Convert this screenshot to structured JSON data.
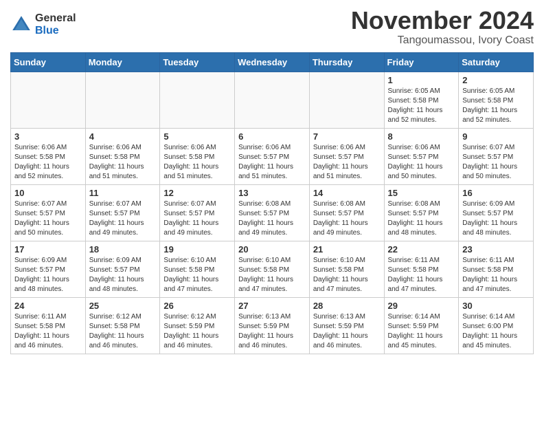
{
  "header": {
    "logo_general": "General",
    "logo_blue": "Blue",
    "month_title": "November 2024",
    "location": "Tangoumassou, Ivory Coast"
  },
  "weekdays": [
    "Sunday",
    "Monday",
    "Tuesday",
    "Wednesday",
    "Thursday",
    "Friday",
    "Saturday"
  ],
  "weeks": [
    [
      {
        "day": "",
        "info": ""
      },
      {
        "day": "",
        "info": ""
      },
      {
        "day": "",
        "info": ""
      },
      {
        "day": "",
        "info": ""
      },
      {
        "day": "",
        "info": ""
      },
      {
        "day": "1",
        "info": "Sunrise: 6:05 AM\nSunset: 5:58 PM\nDaylight: 11 hours\nand 52 minutes."
      },
      {
        "day": "2",
        "info": "Sunrise: 6:05 AM\nSunset: 5:58 PM\nDaylight: 11 hours\nand 52 minutes."
      }
    ],
    [
      {
        "day": "3",
        "info": "Sunrise: 6:06 AM\nSunset: 5:58 PM\nDaylight: 11 hours\nand 52 minutes."
      },
      {
        "day": "4",
        "info": "Sunrise: 6:06 AM\nSunset: 5:58 PM\nDaylight: 11 hours\nand 51 minutes."
      },
      {
        "day": "5",
        "info": "Sunrise: 6:06 AM\nSunset: 5:58 PM\nDaylight: 11 hours\nand 51 minutes."
      },
      {
        "day": "6",
        "info": "Sunrise: 6:06 AM\nSunset: 5:57 PM\nDaylight: 11 hours\nand 51 minutes."
      },
      {
        "day": "7",
        "info": "Sunrise: 6:06 AM\nSunset: 5:57 PM\nDaylight: 11 hours\nand 51 minutes."
      },
      {
        "day": "8",
        "info": "Sunrise: 6:06 AM\nSunset: 5:57 PM\nDaylight: 11 hours\nand 50 minutes."
      },
      {
        "day": "9",
        "info": "Sunrise: 6:07 AM\nSunset: 5:57 PM\nDaylight: 11 hours\nand 50 minutes."
      }
    ],
    [
      {
        "day": "10",
        "info": "Sunrise: 6:07 AM\nSunset: 5:57 PM\nDaylight: 11 hours\nand 50 minutes."
      },
      {
        "day": "11",
        "info": "Sunrise: 6:07 AM\nSunset: 5:57 PM\nDaylight: 11 hours\nand 49 minutes."
      },
      {
        "day": "12",
        "info": "Sunrise: 6:07 AM\nSunset: 5:57 PM\nDaylight: 11 hours\nand 49 minutes."
      },
      {
        "day": "13",
        "info": "Sunrise: 6:08 AM\nSunset: 5:57 PM\nDaylight: 11 hours\nand 49 minutes."
      },
      {
        "day": "14",
        "info": "Sunrise: 6:08 AM\nSunset: 5:57 PM\nDaylight: 11 hours\nand 49 minutes."
      },
      {
        "day": "15",
        "info": "Sunrise: 6:08 AM\nSunset: 5:57 PM\nDaylight: 11 hours\nand 48 minutes."
      },
      {
        "day": "16",
        "info": "Sunrise: 6:09 AM\nSunset: 5:57 PM\nDaylight: 11 hours\nand 48 minutes."
      }
    ],
    [
      {
        "day": "17",
        "info": "Sunrise: 6:09 AM\nSunset: 5:57 PM\nDaylight: 11 hours\nand 48 minutes."
      },
      {
        "day": "18",
        "info": "Sunrise: 6:09 AM\nSunset: 5:57 PM\nDaylight: 11 hours\nand 48 minutes."
      },
      {
        "day": "19",
        "info": "Sunrise: 6:10 AM\nSunset: 5:58 PM\nDaylight: 11 hours\nand 47 minutes."
      },
      {
        "day": "20",
        "info": "Sunrise: 6:10 AM\nSunset: 5:58 PM\nDaylight: 11 hours\nand 47 minutes."
      },
      {
        "day": "21",
        "info": "Sunrise: 6:10 AM\nSunset: 5:58 PM\nDaylight: 11 hours\nand 47 minutes."
      },
      {
        "day": "22",
        "info": "Sunrise: 6:11 AM\nSunset: 5:58 PM\nDaylight: 11 hours\nand 47 minutes."
      },
      {
        "day": "23",
        "info": "Sunrise: 6:11 AM\nSunset: 5:58 PM\nDaylight: 11 hours\nand 47 minutes."
      }
    ],
    [
      {
        "day": "24",
        "info": "Sunrise: 6:11 AM\nSunset: 5:58 PM\nDaylight: 11 hours\nand 46 minutes."
      },
      {
        "day": "25",
        "info": "Sunrise: 6:12 AM\nSunset: 5:58 PM\nDaylight: 11 hours\nand 46 minutes."
      },
      {
        "day": "26",
        "info": "Sunrise: 6:12 AM\nSunset: 5:59 PM\nDaylight: 11 hours\nand 46 minutes."
      },
      {
        "day": "27",
        "info": "Sunrise: 6:13 AM\nSunset: 5:59 PM\nDaylight: 11 hours\nand 46 minutes."
      },
      {
        "day": "28",
        "info": "Sunrise: 6:13 AM\nSunset: 5:59 PM\nDaylight: 11 hours\nand 46 minutes."
      },
      {
        "day": "29",
        "info": "Sunrise: 6:14 AM\nSunset: 5:59 PM\nDaylight: 11 hours\nand 45 minutes."
      },
      {
        "day": "30",
        "info": "Sunrise: 6:14 AM\nSunset: 6:00 PM\nDaylight: 11 hours\nand 45 minutes."
      }
    ]
  ]
}
